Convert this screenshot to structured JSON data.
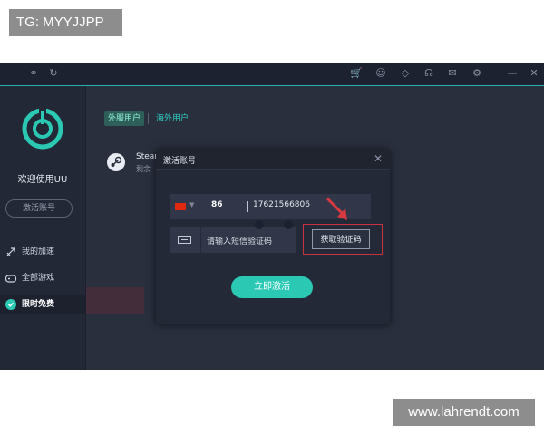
{
  "watermarks": {
    "top_left": "TG: MYYJJPP",
    "bottom_right": "www.lahrendt.com"
  },
  "sidebar": {
    "welcome": "欢迎使用UU",
    "activate_button": "激活账号",
    "nav": [
      {
        "label": "我的加速",
        "icon": "rocket-icon"
      },
      {
        "label": "全部游戏",
        "icon": "gamepad-icon"
      },
      {
        "label": "限时免费",
        "icon": "gift-icon",
        "active": true
      }
    ]
  },
  "content": {
    "tabs": [
      {
        "label": "外服用户",
        "active": true
      },
      {
        "label": "海外用户",
        "active": false
      }
    ],
    "steam_title": "Stear",
    "steam_subtitle": "剩余"
  },
  "dialog": {
    "title": "激活账号",
    "country_code": "86",
    "phone": "17621566806",
    "sms_placeholder": "请输入短信验证码",
    "get_code": "获取验证码",
    "submit": "立即激活"
  },
  "colors": {
    "accent": "#2bc9b4",
    "highlight": "#c8343e",
    "background": "#262b3a"
  }
}
